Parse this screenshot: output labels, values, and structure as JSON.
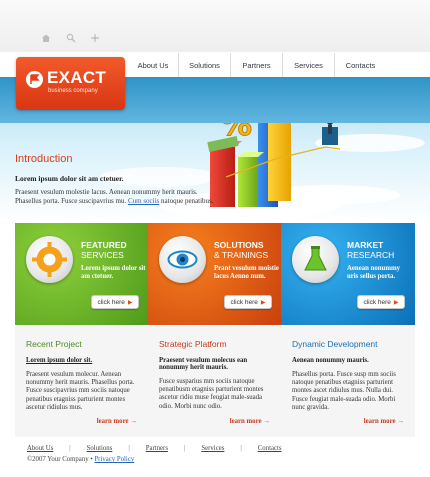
{
  "colors": {
    "accent": "#d8401a",
    "logo_bg": "#e2431c",
    "panel_green": "#6fb52c",
    "panel_orange": "#e45511",
    "panel_blue": "#1a94dc",
    "recent_title": "#4e8a1e",
    "strategic_title": "#c8391a",
    "dynamic_title": "#1a6fb0",
    "link_blue": "#2a63b5"
  },
  "utility_icons": [
    "home-icon",
    "search-icon",
    "sitemap-icon"
  ],
  "logo": {
    "name": "EXACT",
    "tagline": "business company"
  },
  "nav": {
    "items": [
      "About Us",
      "Solutions",
      "Partners",
      "Services",
      "Contacts"
    ]
  },
  "intro": {
    "title": "Introduction",
    "lead": "Lorem ipsum dolor sit am ctetuer.",
    "body": "Praesent vesulum molestie lacus. Aenean nonummy herit mauris. Phasellus porta. Fusce suscipavrius mu.",
    "link": "Cum sociis",
    "body_tail": "natoque penatibus."
  },
  "panels": [
    {
      "title": "FEATURED",
      "subtitle": "SERVICES",
      "text": "Lorem ipsum dolor sit am ctetuer.",
      "button": "click here",
      "icon": "gear-icon"
    },
    {
      "title": "SOLUTIONS",
      "subtitle": "& TRAININGS",
      "text": "Prant vesulum moistie lacus Aenno num.",
      "button": "click here",
      "icon": "eye-icon"
    },
    {
      "title": "MARKET",
      "subtitle": "RESEARCH",
      "text": "Aenean nonummy uris sellus porta.",
      "button": "click here",
      "icon": "flask-icon"
    }
  ],
  "columns": [
    {
      "title": "Recent Project",
      "lead": "Lorem ipsum dolor sit.",
      "body": "Praesent vesulum molecur. Aenean nonummy herit mauris. Phasellus porta. Fusce suscipavrius mm sociis natoque penatibus etagniss parturient montes ascetur ridiulus mus.",
      "more": "learn more"
    },
    {
      "title": "Strategic Platform",
      "lead": "Praesent vesulum molecus ean nonummy herit mauris.",
      "body": "Fusce susparius mm sociis natoque penatibusm etagniss parturient montes ascetur ridiu muse feugiat male-suada odio. Morbi nunc odio.",
      "more": "learn more"
    },
    {
      "title": "Dynamic Development",
      "lead": "Aenean nonummy mauris.",
      "body": "Phasellus porta. Fusce susp mm sociis natoque penatibus etagniss parturient montes ascet ridiulus mus. Nulla dui. Fusce feugiat male-suada odio. Morbi nunc gravida.",
      "more": "learn more"
    }
  ],
  "footer": {
    "links": [
      "About Us",
      "Solutions",
      "Partners",
      "Services",
      "Contacts"
    ],
    "copyright": "©2007 Your Company •",
    "privacy": "Privacy Policy"
  }
}
